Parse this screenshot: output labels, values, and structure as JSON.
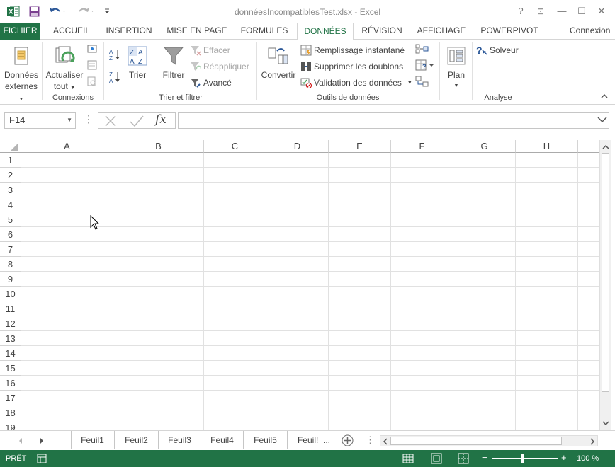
{
  "window": {
    "title": "donnéesIncompatiblesTest.xlsx - Excel",
    "help": "?",
    "restore_ribbon": "⊡",
    "minimize": "—",
    "maximize": "☐",
    "close": "✕"
  },
  "tabs": {
    "file": "FICHIER",
    "home": "ACCUEIL",
    "insert": "INSERTION",
    "layout": "MISE EN PAGE",
    "formulas": "FORMULES",
    "data": "DONNÉES",
    "review": "RÉVISION",
    "view": "AFFICHAGE",
    "powerpivot": "POWERPIVOT",
    "account": "Connexion"
  },
  "ribbon": {
    "ext_data_line1": "Données",
    "ext_data_line2": "externes",
    "refresh_line1": "Actualiser",
    "refresh_line2": "tout",
    "group_connections": "Connexions",
    "sort": "Trier",
    "filter": "Filtrer",
    "clear": "Effacer",
    "reapply": "Réappliquer",
    "advanced": "Avancé",
    "group_sort_filter": "Trier et filtrer",
    "convert": "Convertir",
    "flash_fill": "Remplissage instantané",
    "remove_duplicates": "Supprimer les doublons",
    "data_validation": "Validation des données",
    "group_data_tools": "Outils de données",
    "outline": "Plan",
    "solver": "Solveur",
    "group_analysis": "Analyse"
  },
  "formula_bar": {
    "name_box": "F14",
    "formula": ""
  },
  "grid": {
    "columns": [
      "A",
      "B",
      "C",
      "D",
      "E",
      "F",
      "G",
      "H"
    ],
    "rows": [
      "1",
      "2",
      "3",
      "4",
      "5",
      "6",
      "7",
      "8",
      "9",
      "10",
      "11",
      "12",
      "13",
      "14",
      "15",
      "16",
      "17",
      "18",
      "19"
    ]
  },
  "sheets": [
    "Feuil1",
    "Feuil2",
    "Feuil3",
    "Feuil4",
    "Feuil5",
    "Feuil!"
  ],
  "sheets_more": "...",
  "status": {
    "ready": "PRÊT",
    "zoom": "100 %"
  },
  "colors": {
    "accent": "#217346"
  }
}
